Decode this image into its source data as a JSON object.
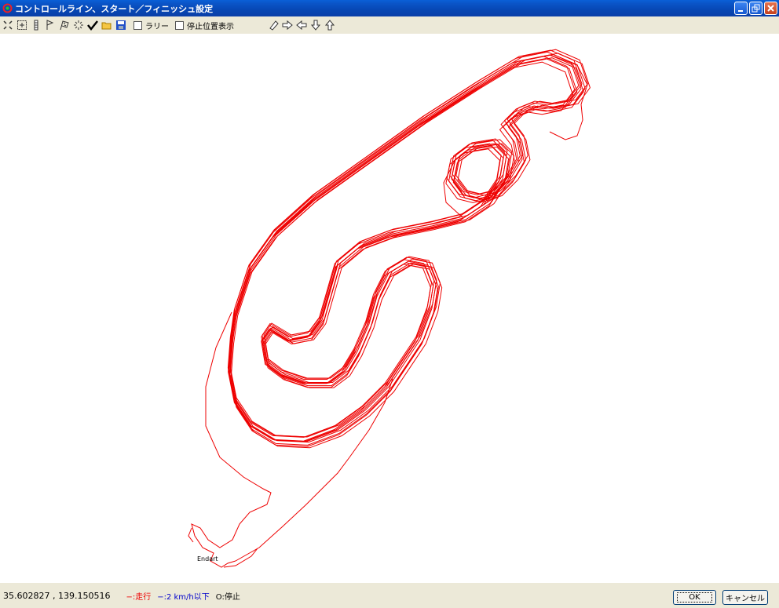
{
  "window": {
    "title": "コントロールライン、スタート／フィニッシュ設定"
  },
  "toolbar": {
    "icons": [
      "zoom-fit-icon",
      "zoom-region-icon",
      "control-line-icon",
      "start-flag-icon",
      "finish-flag-icon",
      "sparkle-icon",
      "check-icon",
      "open-folder-icon",
      "save-icon",
      "eraser-icon",
      "arrow-right-icon",
      "arrow-left-icon",
      "arrow-down-icon",
      "arrow-up-icon"
    ],
    "rally_label": "ラリー",
    "stop_pos_label": "停止位置表示"
  },
  "canvas": {
    "end_label": "End",
    "start_label": "art"
  },
  "status": {
    "coords": "35.602827 , 139.150516",
    "legend_run": "−:走行",
    "legend_slow": "−:2 km/h以下",
    "legend_stop": "O:停止"
  },
  "buttons": {
    "ok": "OK",
    "cancel": "キャンセル"
  },
  "colors": {
    "track": "#e00000",
    "title_bar": "#0a55c8",
    "slow_legend": "#0000cc"
  }
}
